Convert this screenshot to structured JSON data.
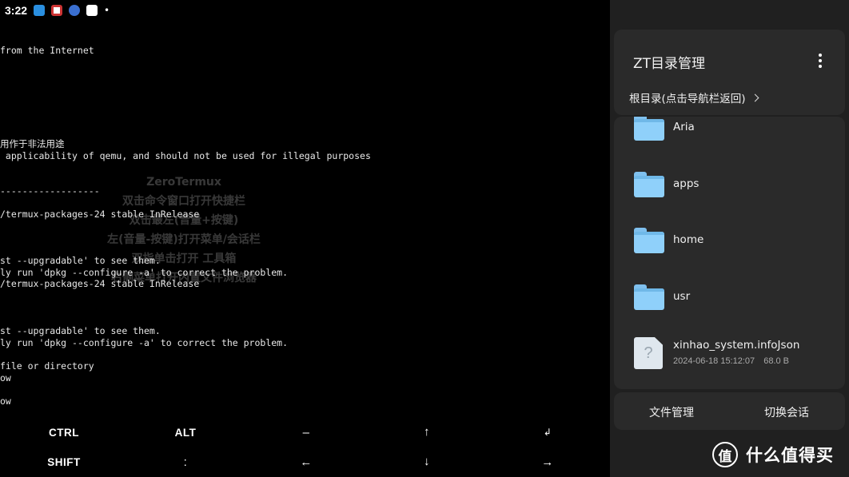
{
  "status_bar": {
    "time": "3:22",
    "icons": [
      "app-icon-blue",
      "app-icon-red",
      "app-icon-globe",
      "app-icon-bird"
    ],
    "dot": "•"
  },
  "terminal": {
    "lines": [
      "from the Internet",
      "用作于非法用途",
      " applicability of qemu, and should not be used for illegal purposes",
      "------------------",
      "/termux-packages-24 stable InRelease",
      "st --upgradable' to see them.",
      "ly run 'dpkg --configure -a' to correct the problem.",
      "/termux-packages-24 stable InRelease",
      "st --upgradable' to see them.",
      "ly run 'dpkg --configure -a' to correct the problem.",
      "file or directory",
      "ow",
      "ow"
    ],
    "hints": [
      "ZeroTermux",
      "双击命令窗口打开快捷栏",
      "双击最左(音量+按键)",
      "左(音量-按键)打开菜单/会话栏",
      "双指单击打开 工具箱",
      "右侧菜单打开内置文件浏览器"
    ]
  },
  "extra_keys": {
    "row1": [
      "CTRL",
      "ALT",
      "–",
      "↑",
      "↲"
    ],
    "row2": [
      "SHIFT",
      ":",
      "←",
      "↓",
      "→"
    ]
  },
  "drawer": {
    "title": "ZT目录管理",
    "menu_icon": "more-vert-icon",
    "breadcrumb": "根目录(点击导航栏返回)",
    "items": [
      {
        "name": "Aria",
        "type": "folder"
      },
      {
        "name": "apps",
        "type": "folder"
      },
      {
        "name": "home",
        "type": "folder"
      },
      {
        "name": "usr",
        "type": "folder"
      },
      {
        "name": "xinhao_system.infoJson",
        "type": "file",
        "date": "2024-06-18 15:12:07",
        "size": "68.0 B",
        "icon_glyph": "?"
      }
    ],
    "footer": {
      "file_manager": "文件管理",
      "switch_session": "切换会话"
    }
  },
  "watermark": {
    "logo_char": "值",
    "text": "什么值得买"
  }
}
